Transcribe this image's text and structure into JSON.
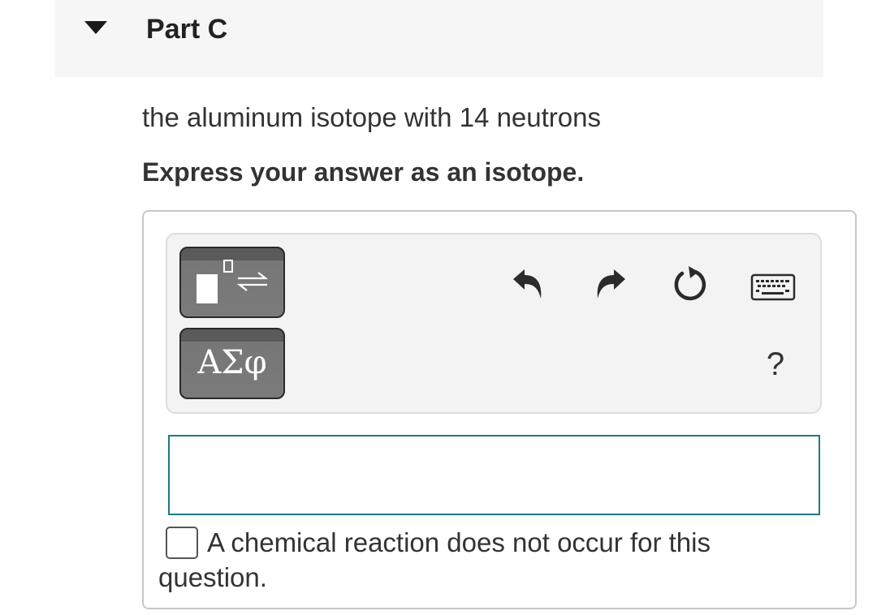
{
  "part": {
    "title": "Part C",
    "collapse_icon": "caret-down-icon"
  },
  "question": {
    "text": "the aluminum isotope with 14 neutrons",
    "instruction": "Express your answer as an isotope."
  },
  "toolbar": {
    "templates_icon": "templates-icon",
    "symbols_label": "ΑΣφ",
    "undo_icon": "undo-icon",
    "redo_icon": "redo-icon",
    "reset_icon": "reset-icon",
    "keyboard_icon": "keyboard-icon",
    "help_label": "?"
  },
  "answer": {
    "value": ""
  },
  "no_reaction": {
    "line1": "A chemical reaction does not occur for this",
    "line2": "question.",
    "checked": false
  },
  "colors": {
    "header_bg": "#f6f6f6",
    "toolbar_bg": "#f3f3f3",
    "tool_button": "#777777",
    "input_border": "#1f7a80",
    "text": "#333333"
  }
}
